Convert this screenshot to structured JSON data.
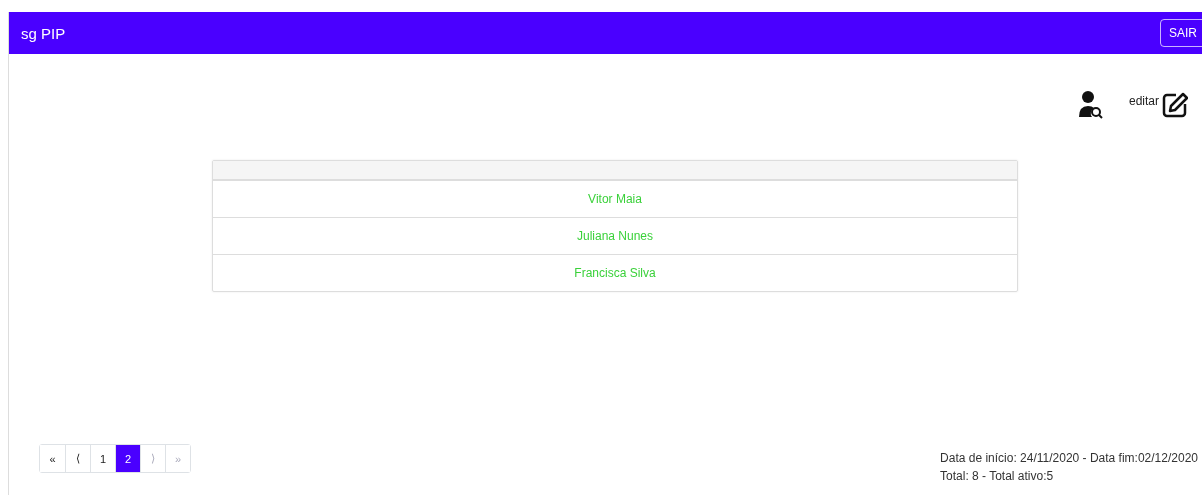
{
  "navbar": {
    "brand": "sg PIP",
    "logout_button": "SAIR"
  },
  "toolbar": {
    "edit_label": "editar"
  },
  "table": {
    "rows": [
      {
        "name": "Vitor Maia"
      },
      {
        "name": "Juliana Nunes"
      },
      {
        "name": "Francisca Silva"
      }
    ]
  },
  "pagination": [
    {
      "label": "«",
      "selected": false,
      "disabled": false
    },
    {
      "label": "⟨",
      "selected": false,
      "disabled": false
    },
    {
      "label": "1",
      "selected": false,
      "disabled": false
    },
    {
      "label": "2",
      "selected": true,
      "disabled": false
    },
    {
      "label": "⟩",
      "selected": false,
      "disabled": true
    },
    {
      "label": "»",
      "selected": false,
      "disabled": true
    }
  ],
  "summary": [
    "Data de início: 24/11/2020 - Data fim:02/12/2020",
    "Total: 8 - Total ativo:5"
  ]
}
